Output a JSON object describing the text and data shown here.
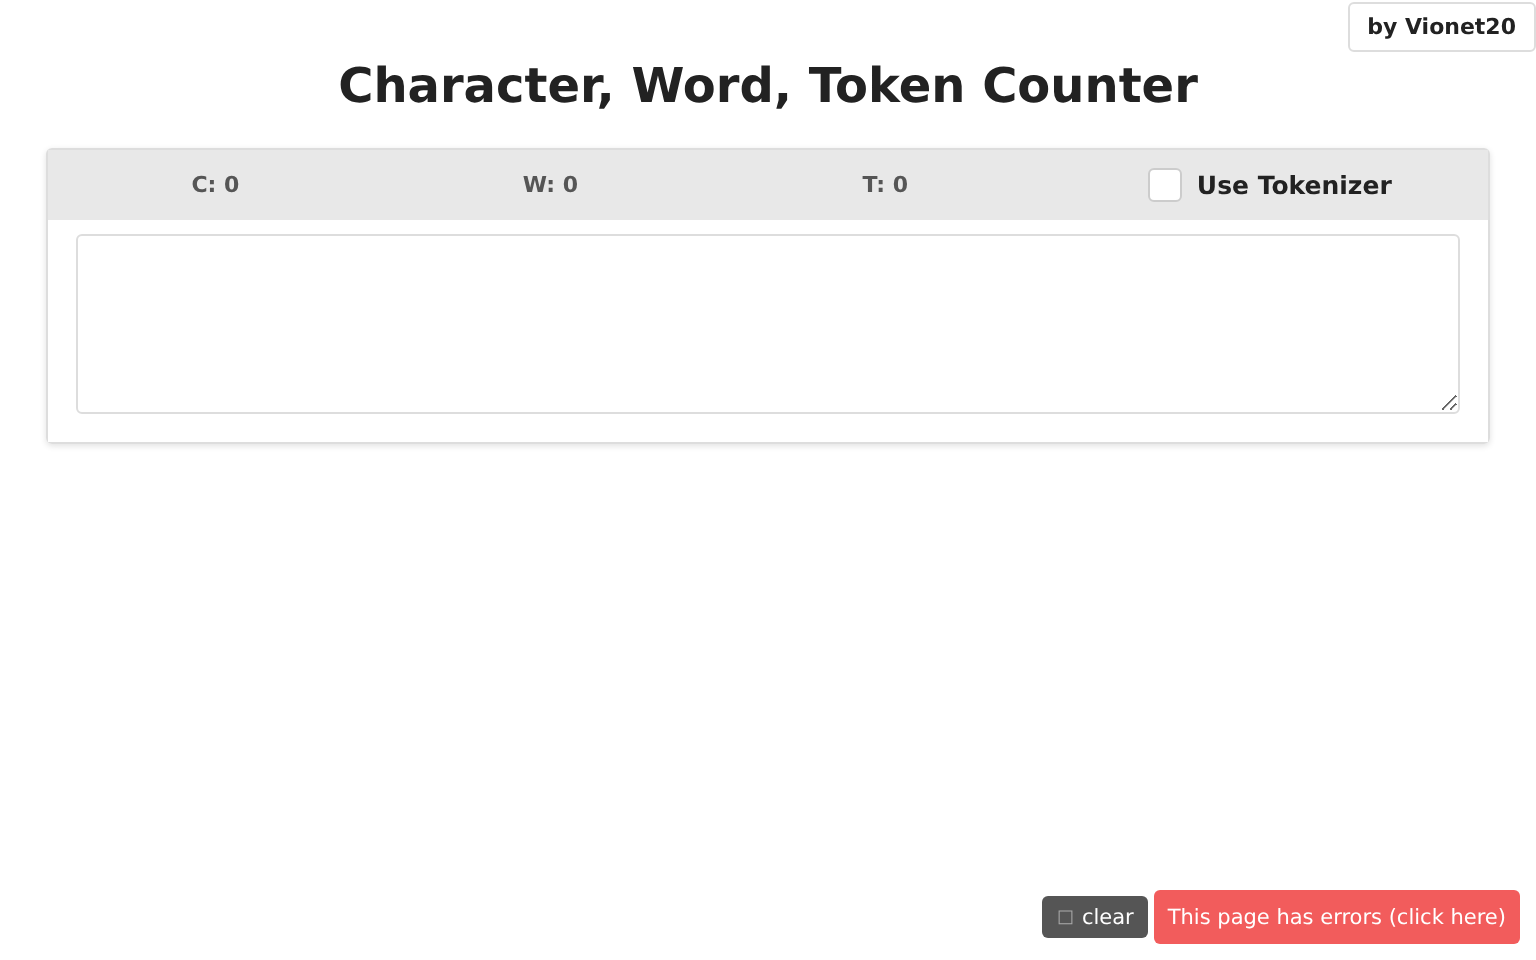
{
  "author_badge": "by Vionet20",
  "title": "Character, Word, Token Counter",
  "counters": [
    {
      "label": "C: 0"
    },
    {
      "label": "W: 0"
    },
    {
      "label": "T: 0"
    }
  ],
  "tokenizer": {
    "label": "Use Tokenizer",
    "checked": false
  },
  "footer": {
    "clear_icon": "□",
    "clear_label": "clear",
    "error_label": "This page has errors (click here)"
  }
}
